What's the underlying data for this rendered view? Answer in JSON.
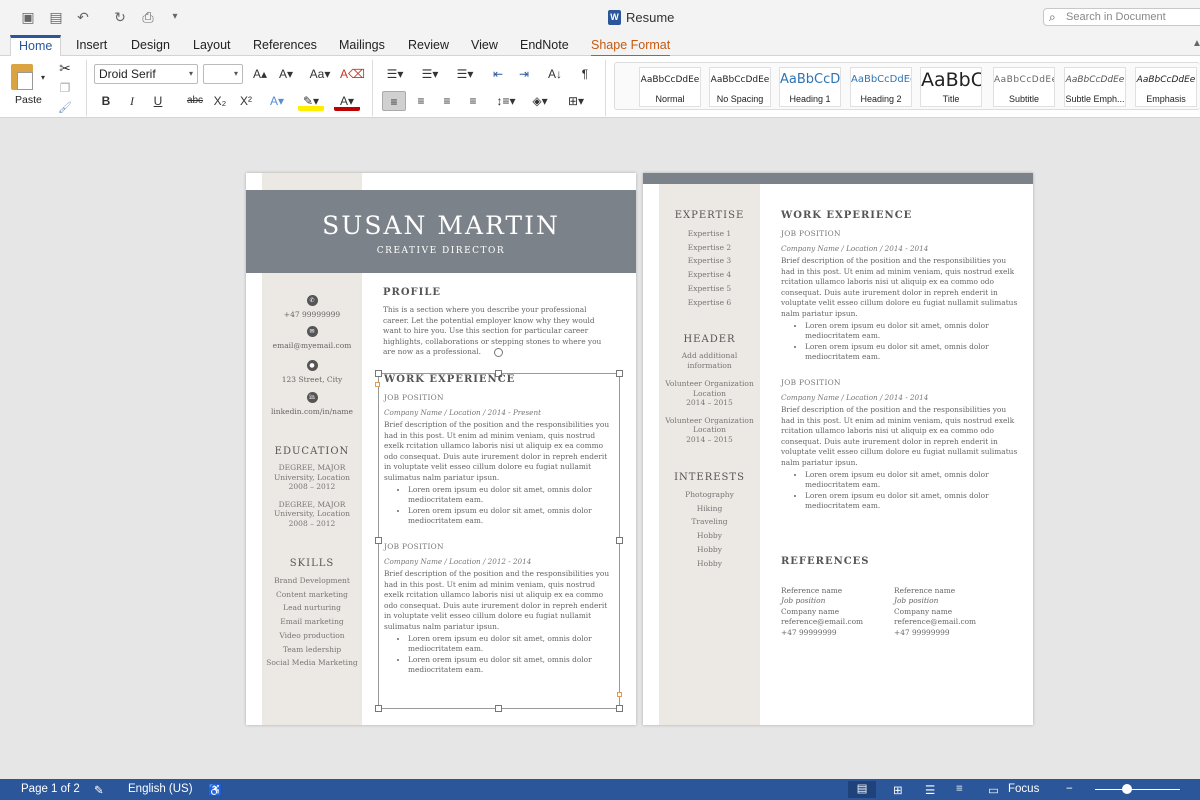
{
  "window": {
    "title": "Resume",
    "search_placeholder": "Search in Document"
  },
  "tabs": [
    "Home",
    "Insert",
    "Design",
    "Layout",
    "References",
    "Mailings",
    "Review",
    "View",
    "EndNote",
    "Shape Format"
  ],
  "ribbon": {
    "paste_label": "Paste",
    "font_name": "Droid Serif",
    "font_size": "",
    "styles": [
      {
        "preview": "AaBbCcDdEe",
        "name": "Normal"
      },
      {
        "preview": "AaBbCcDdEe",
        "name": "No Spacing"
      },
      {
        "preview": "AaBbCcDc",
        "name": "Heading 1"
      },
      {
        "preview": "AaBbCcDdEe",
        "name": "Heading 2"
      },
      {
        "preview": "AaBbC",
        "name": "Title"
      },
      {
        "preview": "AaBbCcDdEe",
        "name": "Subtitle"
      },
      {
        "preview": "AaBbCcDdEe",
        "name": "Subtle Emph..."
      },
      {
        "preview": "AaBbCcDdEe",
        "name": "Emphasis"
      }
    ]
  },
  "page1": {
    "name": "SUSAN MARTIN",
    "job_title": "CREATIVE DIRECTOR",
    "contact": {
      "phone": "+47 99999999",
      "email": "email@myemail.com",
      "address": "123 Street, City",
      "linkedin": "linkedin.com/in/name"
    },
    "education": {
      "heading": "EDUCATION",
      "entries": [
        {
          "degree": "DEGREE, MAJOR",
          "school": "University, Location",
          "years": "2008 – 2012"
        },
        {
          "degree": "DEGREE, MAJOR",
          "school": "University, Location",
          "years": "2008 – 2012"
        }
      ]
    },
    "skills": {
      "heading": "SKILLS",
      "items": [
        "Brand Development",
        "Content marketing",
        "Lead nurturing",
        "Email marketing",
        "Video production",
        "Team ledership",
        "Social Media Marketing"
      ]
    },
    "profile": {
      "heading": "PROFILE",
      "text": "This is a section where you describe your professional career. Let the potential employer know why they would want to hire you. Use this section for particular career highlights, collaborations or stepping stones to where you are now as a professional."
    },
    "work": {
      "heading": "WORK EXPERIENCE",
      "jobs": [
        {
          "position": "JOB POSITION",
          "company": "Company Name / Location / 2014 - Present",
          "desc": "Brief description of the position and the responsibilities you had in this post. Ut enim ad minim veniam, quis nostrud exelk rcitation ullamco laboris nisi ut aliquip ex ea commo odo consequat. Duis aute irurement dolor in repreh enderit in voluptate velit esseo cillum dolore eu fugiat nullamit sulimatus nalm pariatur ipsun.",
          "bullets": [
            "Loren orem ipsum eu dolor sit amet, omnis dolor mediocritatem eam.",
            "Loren orem ipsum eu dolor sit amet, omnis dolor mediocritatem eam."
          ]
        },
        {
          "position": "JOB POSITION",
          "company": "Company Name / Location / 2012 - 2014",
          "desc": "Brief description of the position and the responsibilities you had in this post. Ut enim ad minim veniam, quis nostrud exelk rcitation ullamco laboris nisi ut aliquip ex ea commo odo consequat. Duis aute irurement dolor in repreh enderit in voluptate velit esseo cillum dolore eu fugiat nullamit sulimatus nalm pariatur ipsun.",
          "bullets": [
            "Loren orem ipsum eu dolor sit amet, omnis dolor mediocritatem eam.",
            "Loren orem ipsum eu dolor sit amet, omnis dolor mediocritatem eam."
          ]
        }
      ]
    }
  },
  "page2": {
    "expertise": {
      "heading": "EXPERTISE",
      "items": [
        "Expertise 1",
        "Expertise 2",
        "Expertise 3",
        "Expertise 4",
        "Expertise 5",
        "Expertise 6"
      ]
    },
    "header": {
      "heading": "HEADER",
      "lines": [
        "Add additional",
        "information"
      ],
      "entries": [
        {
          "org": "Volunteer Organization",
          "loc": "Location",
          "years": "2014 – 2015"
        },
        {
          "org": "Volunteer Organization",
          "loc": "Location",
          "years": "2014 – 2015"
        }
      ]
    },
    "interests": {
      "heading": "INTERESTS",
      "items": [
        "Photography",
        "Hiking",
        "Traveling",
        "Hobby",
        "Hobby",
        "Hobby"
      ]
    },
    "work": {
      "heading": "WORK EXPERIENCE",
      "jobs": [
        {
          "position": "JOB POSITION",
          "company": "Company Name / Location / 2014 - 2014",
          "desc": "Brief description of the position and the responsibilities you had in this post. Ut enim ad minim veniam, quis nostrud exelk rcitation ullamco laboris nisi ut aliquip ex ea commo odo consequat. Duis aute irurement dolor in repreh enderit in voluptate velit esseo cillum dolore eu fugiat nullamit sulimatus nalm pariatur ipsun.",
          "bullets": [
            "Loren orem ipsum eu dolor sit amet, omnis dolor mediocritatem eam.",
            "Loren orem ipsum eu dolor sit amet, omnis dolor mediocritatem eam."
          ]
        },
        {
          "position": "JOB POSITION",
          "company": "Company Name / Location / 2014 - 2014",
          "desc": "Brief description of the position and the responsibilities you had in this post. Ut enim ad minim veniam, quis nostrud exelk rcitation ullamco laboris nisi ut aliquip ex ea commo odo consequat. Duis aute irurement dolor in repreh enderit in voluptate velit esseo cillum dolore eu fugiat nullamit sulimatus nalm pariatur ipsun.",
          "bullets": [
            "Loren orem ipsum eu dolor sit amet, omnis dolor mediocritatem eam.",
            "Loren orem ipsum eu dolor sit amet, omnis dolor mediocritatem eam."
          ]
        }
      ]
    },
    "references": {
      "heading": "REFERENCES",
      "people": [
        {
          "name": "Reference name",
          "position": "Job position",
          "company": "Company name",
          "email": "reference@email.com",
          "phone": "+47 99999999"
        },
        {
          "name": "Reference name",
          "position": "Job position",
          "company": "Company name",
          "email": "reference@email.com",
          "phone": "+47 99999999"
        }
      ]
    }
  },
  "status": {
    "page": "Page 1 of 2",
    "language": "English (US)",
    "focus": "Focus"
  },
  "colors": {
    "accent": "#2b579a",
    "shape_format": "#c55a11",
    "banner": "#7c8289",
    "sidebar": "#ece8e3"
  }
}
